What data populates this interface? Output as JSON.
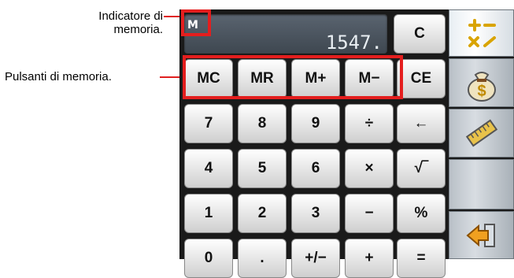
{
  "annotations": {
    "memory_indicator": [
      "Indicatore di",
      "memoria."
    ],
    "memory_buttons": "Pulsanti di memoria."
  },
  "display": {
    "memory_flag": "M",
    "value": "1547."
  },
  "keys": {
    "c": "C",
    "mc": "MC",
    "mr": "MR",
    "mplus": "M+",
    "mminus": "M−",
    "ce": "CE",
    "k7": "7",
    "k8": "8",
    "k9": "9",
    "div": "÷",
    "back": "←",
    "k4": "4",
    "k5": "5",
    "k6": "6",
    "mul": "×",
    "sqrt": "√‾",
    "k1": "1",
    "k2": "2",
    "k3": "3",
    "sub": "−",
    "pct": "%",
    "k0": "0",
    "dot": ".",
    "sign": "+/−",
    "add": "+",
    "eq": "="
  },
  "sidebar": {
    "items": [
      {
        "icon": "calculator-mode-icon",
        "active": true
      },
      {
        "icon": "money-bag-icon",
        "active": false
      },
      {
        "icon": "ruler-icon",
        "active": false
      },
      {
        "icon": "blank",
        "active": false
      },
      {
        "icon": "exit-arrow-icon",
        "active": false
      }
    ]
  },
  "colors": {
    "highlight": "#e41e1e",
    "frame": "#1a1a1a"
  }
}
